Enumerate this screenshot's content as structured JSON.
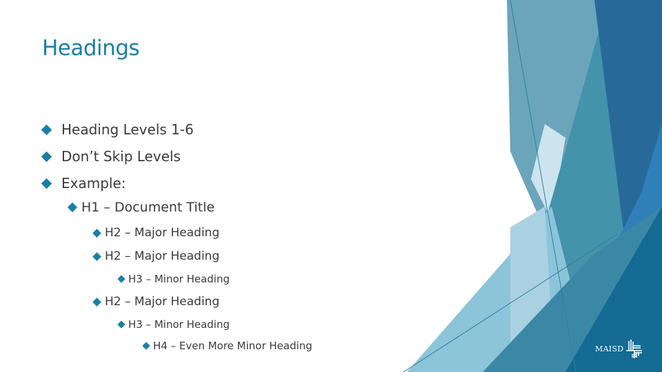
{
  "slide": {
    "title": "Headings",
    "bullets": [
      {
        "level": 1,
        "text": "Heading Levels 1-6"
      },
      {
        "level": 1,
        "text": "Don’t Skip Levels"
      },
      {
        "level": 1,
        "text": "Example:"
      },
      {
        "level": 2,
        "text": "H1 – Document Title"
      },
      {
        "level": 3,
        "text": "H2 – Major Heading"
      },
      {
        "level": 3,
        "text": "H2 – Major Heading"
      },
      {
        "level": 4,
        "text": "H3 – Minor Heading"
      },
      {
        "level": 3,
        "text": "H2 – Major Heading"
      },
      {
        "level": 4,
        "text": "H3 – Minor Heading"
      },
      {
        "level": 5,
        "text": "H4 – Even More Minor Heading"
      }
    ]
  },
  "logo": {
    "text": "MAISD",
    "icon": "maisd-logo-icon"
  },
  "colors": {
    "accent": "#1a7fa8",
    "body_text": "#3a3a3a",
    "facet_dark": "#276a9a",
    "facet_teal": "#4393aa",
    "facet_light": "#8cc4da",
    "facet_pale": "#cde4ee",
    "facet_mid": "#6aa5bc"
  }
}
